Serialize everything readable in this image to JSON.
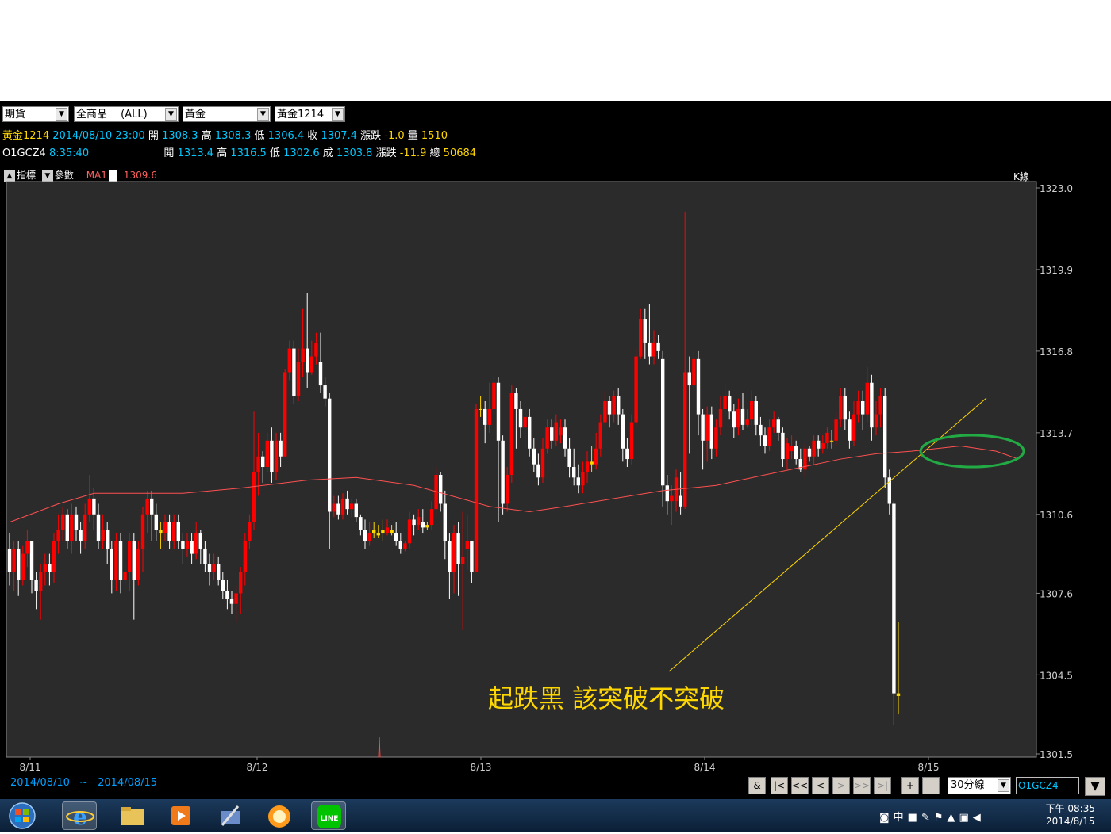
{
  "selectors": [
    {
      "value": "期貨"
    },
    {
      "value": "全商品 　(ALL)"
    },
    {
      "value": "黃金"
    },
    {
      "value": "黃金1214"
    }
  ],
  "quote1": {
    "name": "黃金1214",
    "datetime": "2014/08/10 23:00",
    "open_label": "開",
    "open": "1308.3",
    "high_label": "高",
    "high": "1308.3",
    "low_label": "低",
    "low": "1306.4",
    "close_label": "收",
    "close": "1307.4",
    "change_label": "漲跌",
    "change": "-1.0",
    "volume_label": "量",
    "volume": "1510"
  },
  "quote2": {
    "name": "O1GCZ4",
    "time": "8:35:40",
    "open_label": "開",
    "open": "1313.4",
    "high_label": "高",
    "high": "1316.5",
    "low_label": "低",
    "low": "1302.6",
    "close_label": "成",
    "close": "1303.8",
    "change_label": "漲跌",
    "change": "-11.9",
    "volume_label": "總",
    "volume": "50684"
  },
  "toolbar": {
    "indicator_label": "指標",
    "param_label": "參數",
    "ma_label": "MA1",
    "ma_value": "1309.6",
    "k_label": "K線"
  },
  "range": {
    "from": "2014/08/10",
    "sep": "~",
    "to": "2014/08/15"
  },
  "nav": {
    "amp": "&",
    "first": "|<",
    "fastback": "<<",
    "back": "<",
    "fwd": ">",
    "fastfwd": ">>",
    "last": ">|",
    "zoom_in": "+",
    "zoom_out": "-",
    "period": "30分線",
    "code": "O1GCZ4"
  },
  "annotation": "起跌黑 該突破不突破",
  "taskbar": {
    "time": "下午 08:35",
    "date": "2014/8/15",
    "ime": "中",
    "apps": [
      "windows-start",
      "internet-explorer",
      "file-explorer",
      "media-player",
      "tool-app",
      "chat-app",
      "line"
    ]
  },
  "colors": {
    "background": "#000000",
    "plot_bg": "#2b2b2b",
    "up": "#ff0000",
    "down": "#ffffff",
    "doji": "#ffd700",
    "ma": "#ff5050",
    "trendline": "#ffd700",
    "ellipse": "#22aa44"
  },
  "chart_data": {
    "type": "candlestick",
    "title": "",
    "xlabel": "",
    "ylabel": "",
    "ylim": [
      1301.5,
      1323.0
    ],
    "y_ticks": [
      "1323.0",
      "1319.9",
      "1316.8",
      "1313.7",
      "1310.6",
      "1307.6",
      "1304.5",
      "1301.5"
    ],
    "x_ticks": [
      "8/11",
      "8/12",
      "8/13",
      "8/14",
      "8/15"
    ],
    "candles": [
      [
        1309.3,
        1308.4,
        1309.9,
        1307.9
      ],
      [
        1308.4,
        1309.3,
        1309.6,
        1307.7
      ],
      [
        1309.3,
        1308.1,
        1309.6,
        1307.5
      ],
      [
        1308.1,
        1309.1,
        1309.4,
        1307.9
      ],
      [
        1309.1,
        1309.6,
        1310.0,
        1308.6
      ],
      [
        1309.6,
        1308.1,
        1309.6,
        1307.6
      ],
      [
        1308.1,
        1307.7,
        1308.4,
        1307.0
      ],
      [
        1307.7,
        1308.4,
        1308.7,
        1306.6
      ],
      [
        1308.4,
        1308.7,
        1309.1,
        1307.9
      ],
      [
        1308.7,
        1308.4,
        1309.1,
        1307.9
      ],
      [
        1308.4,
        1309.6,
        1309.9,
        1308.0
      ],
      [
        1309.6,
        1310.0,
        1310.6,
        1309.1
      ],
      [
        1310.0,
        1310.6,
        1310.9,
        1309.6
      ],
      [
        1310.6,
        1309.6,
        1310.8,
        1309.3
      ],
      [
        1309.6,
        1310.6,
        1311.0,
        1309.1
      ],
      [
        1310.6,
        1310.0,
        1310.9,
        1309.6
      ],
      [
        1310.0,
        1309.6,
        1310.3,
        1309.1
      ],
      [
        1309.6,
        1310.6,
        1311.0,
        1309.3
      ],
      [
        1310.6,
        1311.2,
        1312.1,
        1310.3
      ],
      [
        1311.2,
        1310.6,
        1311.6,
        1310.0
      ],
      [
        1310.6,
        1309.6,
        1311.0,
        1309.3
      ],
      [
        1309.6,
        1310.0,
        1310.6,
        1309.3
      ],
      [
        1310.0,
        1309.3,
        1310.3,
        1308.7
      ],
      [
        1309.3,
        1308.1,
        1309.6,
        1307.6
      ],
      [
        1308.1,
        1309.6,
        1309.9,
        1307.7
      ],
      [
        1309.6,
        1308.1,
        1309.9,
        1307.6
      ],
      [
        1308.1,
        1308.4,
        1308.7,
        1307.9
      ],
      [
        1308.4,
        1309.6,
        1309.9,
        1307.7
      ],
      [
        1309.6,
        1308.1,
        1309.9,
        1306.6
      ],
      [
        1308.1,
        1309.3,
        1309.6,
        1307.9
      ],
      [
        1309.3,
        1310.6,
        1310.9,
        1308.4
      ],
      [
        1310.6,
        1311.2,
        1311.5,
        1309.9
      ],
      [
        1311.2,
        1310.6,
        1311.5,
        1309.6
      ],
      [
        1310.6,
        1310.0,
        1311.0,
        1309.6
      ],
      [
        1310.0,
        1309.9,
        1310.3,
        1309.3
      ],
      [
        1309.9,
        1310.3,
        1310.6,
        1309.6
      ],
      [
        1310.3,
        1309.6,
        1310.6,
        1309.3
      ],
      [
        1309.6,
        1310.3,
        1310.6,
        1309.3
      ],
      [
        1310.3,
        1309.6,
        1310.6,
        1309.3
      ],
      [
        1309.6,
        1309.3,
        1309.9,
        1308.7
      ],
      [
        1309.3,
        1309.6,
        1309.9,
        1309.0
      ],
      [
        1309.6,
        1309.1,
        1309.9,
        1308.7
      ],
      [
        1309.1,
        1309.9,
        1310.3,
        1308.9
      ],
      [
        1309.9,
        1309.3,
        1310.0,
        1308.7
      ],
      [
        1309.3,
        1308.7,
        1309.6,
        1308.4
      ],
      [
        1308.7,
        1308.4,
        1309.1,
        1307.9
      ],
      [
        1308.4,
        1308.7,
        1309.1,
        1308.1
      ],
      [
        1308.7,
        1308.1,
        1309.0,
        1307.9
      ],
      [
        1308.1,
        1307.7,
        1308.4,
        1307.4
      ],
      [
        1307.7,
        1307.4,
        1308.1,
        1307.0
      ],
      [
        1307.4,
        1307.2,
        1307.7,
        1306.8
      ],
      [
        1307.2,
        1307.6,
        1307.9,
        1306.5
      ],
      [
        1307.6,
        1308.4,
        1308.6,
        1306.8
      ],
      [
        1308.4,
        1309.6,
        1309.9,
        1307.9
      ],
      [
        1309.6,
        1310.3,
        1310.6,
        1309.3
      ],
      [
        1310.3,
        1312.2,
        1314.5,
        1310.0
      ],
      [
        1312.2,
        1312.8,
        1313.7,
        1311.3
      ],
      [
        1312.8,
        1312.4,
        1313.0,
        1311.8
      ],
      [
        1312.4,
        1313.4,
        1313.7,
        1312.2
      ],
      [
        1313.4,
        1312.2,
        1313.9,
        1311.8
      ],
      [
        1312.2,
        1313.4,
        1313.7,
        1311.9
      ],
      [
        1313.4,
        1312.8,
        1313.7,
        1312.4
      ],
      [
        1312.8,
        1316.0,
        1316.1,
        1312.8
      ],
      [
        1316.0,
        1316.9,
        1317.2,
        1315.7
      ],
      [
        1316.9,
        1315.1,
        1317.2,
        1314.8
      ],
      [
        1315.1,
        1316.4,
        1316.9,
        1314.9
      ],
      [
        1316.4,
        1316.9,
        1318.4,
        1315.8
      ],
      [
        1316.9,
        1316.0,
        1319.0,
        1315.4
      ],
      [
        1316.0,
        1316.6,
        1317.2,
        1315.9
      ],
      [
        1316.6,
        1317.1,
        1317.5,
        1316.3
      ],
      [
        1316.4,
        1315.5,
        1317.5,
        1315.2
      ],
      [
        1315.5,
        1315.0,
        1315.8,
        1314.7
      ],
      [
        1315.0,
        1310.7,
        1315.2,
        1309.3
      ],
      [
        1310.7,
        1311.0,
        1311.3,
        1310.5
      ],
      [
        1311.0,
        1310.6,
        1311.3,
        1310.4
      ],
      [
        1310.6,
        1311.2,
        1311.4,
        1310.4
      ],
      [
        1311.2,
        1310.8,
        1311.5,
        1310.6
      ],
      [
        1310.8,
        1311.0,
        1311.2,
        1310.5
      ],
      [
        1311.0,
        1310.5,
        1311.2,
        1310.3
      ],
      [
        1310.5,
        1310.0,
        1310.6,
        1309.8
      ],
      [
        1310.0,
        1309.6,
        1310.4,
        1309.3
      ],
      [
        1309.6,
        1309.9,
        1310.3,
        1309.4
      ],
      [
        1309.9,
        1310.0,
        1310.3,
        1309.7
      ],
      [
        1309.8,
        1309.9,
        1310.2,
        1309.7
      ],
      [
        1309.9,
        1310.0,
        1310.4,
        1309.6
      ],
      [
        1309.9,
        1310.1,
        1310.4,
        1309.8
      ],
      [
        1309.9,
        1310.0,
        1310.2,
        1309.8
      ],
      [
        1309.9,
        1309.6,
        1310.3,
        1309.4
      ],
      [
        1309.6,
        1309.3,
        1309.9,
        1309.1
      ],
      [
        1309.3,
        1309.5,
        1309.6,
        1309.2
      ],
      [
        1309.5,
        1310.4,
        1310.7,
        1309.3
      ],
      [
        1310.4,
        1310.2,
        1310.6,
        1309.8
      ],
      [
        1310.2,
        1310.5,
        1310.8,
        1310.0
      ],
      [
        1310.3,
        1310.1,
        1310.8,
        1309.9
      ],
      [
        1310.1,
        1310.2,
        1310.3,
        1310.0
      ],
      [
        1310.2,
        1310.8,
        1311.1,
        1310.0
      ],
      [
        1310.8,
        1312.1,
        1312.4,
        1310.5
      ],
      [
        1312.1,
        1311.0,
        1312.2,
        1310.7
      ],
      [
        1311.0,
        1309.6,
        1311.5,
        1308.9
      ],
      [
        1309.6,
        1308.4,
        1309.9,
        1307.4
      ],
      [
        1308.4,
        1309.9,
        1310.2,
        1307.6
      ],
      [
        1309.9,
        1308.7,
        1310.3,
        1307.5
      ],
      [
        1308.7,
        1309.0,
        1310.7,
        1306.2
      ],
      [
        1309.3,
        1309.6,
        1310.6,
        1308.5
      ],
      [
        1309.6,
        1308.4,
        1309.6,
        1308.0
      ],
      [
        1308.4,
        1314.6,
        1314.8,
        1308.4
      ],
      [
        1314.6,
        1314.6,
        1315.1,
        1314.3
      ],
      [
        1314.6,
        1314.0,
        1314.9,
        1313.3
      ],
      [
        1314.0,
        1314.6,
        1315.6,
        1313.7
      ],
      [
        1314.6,
        1315.6,
        1315.9,
        1314.4
      ],
      [
        1315.6,
        1313.4,
        1315.8,
        1310.3
      ],
      [
        1313.4,
        1311.0,
        1313.6,
        1310.6
      ],
      [
        1311.0,
        1312.1,
        1312.4,
        1310.7
      ],
      [
        1312.1,
        1315.2,
        1315.5,
        1311.8
      ],
      [
        1315.2,
        1314.6,
        1315.4,
        1313.1
      ],
      [
        1314.6,
        1313.9,
        1314.9,
        1313.5
      ],
      [
        1313.9,
        1314.3,
        1314.6,
        1313.1
      ],
      [
        1314.3,
        1313.1,
        1314.6,
        1312.8
      ],
      [
        1313.1,
        1312.5,
        1313.5,
        1312.2
      ],
      [
        1312.5,
        1312.0,
        1312.9,
        1311.7
      ],
      [
        1312.0,
        1313.1,
        1313.5,
        1311.8
      ],
      [
        1313.1,
        1313.9,
        1314.2,
        1312.9
      ],
      [
        1313.9,
        1313.4,
        1314.2,
        1313.1
      ],
      [
        1313.4,
        1314.1,
        1314.4,
        1313.2
      ],
      [
        1313.6,
        1313.9,
        1314.2,
        1313.3
      ],
      [
        1313.9,
        1313.1,
        1314.2,
        1312.8
      ],
      [
        1313.1,
        1312.4,
        1313.5,
        1312.0
      ],
      [
        1312.4,
        1312.0,
        1313.1,
        1311.7
      ],
      [
        1312.0,
        1311.7,
        1312.5,
        1311.4
      ],
      [
        1311.7,
        1312.2,
        1312.6,
        1311.4
      ],
      [
        1312.2,
        1312.6,
        1313.0,
        1311.8
      ],
      [
        1312.6,
        1312.5,
        1313.2,
        1312.2
      ],
      [
        1312.5,
        1313.1,
        1313.7,
        1312.3
      ],
      [
        1313.1,
        1314.1,
        1314.4,
        1312.8
      ],
      [
        1314.1,
        1314.9,
        1315.3,
        1313.9
      ],
      [
        1314.9,
        1314.4,
        1315.1,
        1313.9
      ],
      [
        1314.4,
        1315.1,
        1315.3,
        1314.1
      ],
      [
        1315.1,
        1314.4,
        1315.4,
        1314.0
      ],
      [
        1314.4,
        1313.1,
        1314.6,
        1312.6
      ],
      [
        1313.1,
        1312.7,
        1313.5,
        1312.4
      ],
      [
        1312.7,
        1314.1,
        1314.4,
        1312.5
      ],
      [
        1314.1,
        1316.6,
        1316.9,
        1313.9
      ],
      [
        1316.6,
        1318.0,
        1318.4,
        1316.5
      ],
      [
        1318.0,
        1317.1,
        1318.4,
        1316.5
      ],
      [
        1317.1,
        1316.6,
        1318.6,
        1316.3
      ],
      [
        1316.6,
        1317.1,
        1317.6,
        1316.3
      ],
      [
        1317.1,
        1316.8,
        1317.4,
        1316.5
      ],
      [
        1316.5,
        1311.7,
        1316.8,
        1310.9
      ],
      [
        1311.7,
        1311.1,
        1312.1,
        1310.6
      ],
      [
        1311.1,
        1311.3,
        1311.7,
        1310.2
      ],
      [
        1311.1,
        1312.0,
        1312.3,
        1310.7
      ],
      [
        1311.3,
        1310.9,
        1312.2,
        1310.6
      ],
      [
        1310.9,
        1316.0,
        1322.1,
        1310.8
      ],
      [
        1316.0,
        1315.5,
        1316.6,
        1312.9
      ],
      [
        1315.5,
        1316.5,
        1316.8,
        1314.7
      ],
      [
        1316.5,
        1314.4,
        1316.8,
        1313.6
      ],
      [
        1314.4,
        1313.4,
        1314.6,
        1312.3
      ],
      [
        1313.4,
        1314.4,
        1314.7,
        1312.6
      ],
      [
        1314.4,
        1313.1,
        1314.7,
        1312.7
      ],
      [
        1313.1,
        1313.9,
        1314.2,
        1312.8
      ],
      [
        1313.9,
        1314.6,
        1315.1,
        1313.6
      ],
      [
        1314.6,
        1315.1,
        1315.6,
        1314.3
      ],
      [
        1315.1,
        1314.5,
        1315.3,
        1314.2
      ],
      [
        1314.5,
        1313.9,
        1314.8,
        1313.5
      ],
      [
        1313.9,
        1314.6,
        1315.0,
        1313.6
      ],
      [
        1314.6,
        1314.0,
        1315.2,
        1313.8
      ],
      [
        1314.0,
        1314.2,
        1314.6,
        1313.9
      ],
      [
        1314.2,
        1314.9,
        1315.3,
        1314.0
      ],
      [
        1314.9,
        1314.0,
        1315.1,
        1313.6
      ],
      [
        1314.0,
        1313.6,
        1314.3,
        1313.2
      ],
      [
        1313.6,
        1313.2,
        1313.9,
        1312.9
      ],
      [
        1313.2,
        1313.9,
        1314.2,
        1313.0
      ],
      [
        1313.9,
        1314.2,
        1314.5,
        1313.7
      ],
      [
        1314.2,
        1313.7,
        1314.3,
        1313.4
      ],
      [
        1313.7,
        1312.7,
        1313.9,
        1312.4
      ],
      [
        1312.7,
        1313.3,
        1313.5,
        1312.3
      ],
      [
        1313.0,
        1313.2,
        1313.6,
        1312.7
      ],
      [
        1313.2,
        1312.7,
        1313.4,
        1312.5
      ],
      [
        1312.7,
        1312.3,
        1313.1,
        1312.2
      ],
      [
        1312.3,
        1313.1,
        1313.3,
        1312.0
      ],
      [
        1313.1,
        1312.8,
        1313.2,
        1312.6
      ],
      [
        1312.8,
        1313.4,
        1313.6,
        1312.5
      ],
      [
        1313.4,
        1313.1,
        1313.6,
        1312.8
      ],
      [
        1313.1,
        1313.3,
        1313.6,
        1312.9
      ],
      [
        1313.3,
        1313.7,
        1313.9,
        1313.1
      ],
      [
        1313.4,
        1313.4,
        1313.8,
        1313.1
      ],
      [
        1313.4,
        1314.2,
        1314.5,
        1313.2
      ],
      [
        1314.2,
        1315.1,
        1315.4,
        1313.9
      ],
      [
        1315.1,
        1314.2,
        1315.4,
        1313.8
      ],
      [
        1314.2,
        1313.4,
        1314.5,
        1313.1
      ],
      [
        1313.4,
        1314.4,
        1314.9,
        1313.2
      ],
      [
        1314.4,
        1314.9,
        1315.3,
        1314.1
      ],
      [
        1314.9,
        1314.4,
        1315.3,
        1313.8
      ],
      [
        1314.4,
        1315.6,
        1316.2,
        1314.1
      ],
      [
        1315.6,
        1313.9,
        1315.9,
        1313.4
      ],
      [
        1313.9,
        1314.4,
        1314.9,
        1313.6
      ],
      [
        1314.4,
        1315.1,
        1315.4,
        1313.9
      ],
      [
        1315.1,
        1312.0,
        1315.4,
        1311.6
      ],
      [
        1312.0,
        1311.0,
        1312.3,
        1310.6
      ],
      [
        1311.0,
        1303.8,
        1311.1,
        1302.6
      ],
      [
        1303.8,
        1303.7,
        1306.5,
        1303.0
      ]
    ],
    "ma_series": {
      "name": "MA1",
      "points": [
        [
          0,
          1310.3
        ],
        [
          11,
          1311.0
        ],
        [
          19,
          1311.4
        ],
        [
          39,
          1311.4
        ],
        [
          52,
          1311.6
        ],
        [
          67,
          1311.9
        ],
        [
          78,
          1312.0
        ],
        [
          91,
          1311.7
        ],
        [
          108,
          1310.9
        ],
        [
          117,
          1310.7
        ],
        [
          125,
          1310.9
        ],
        [
          147,
          1311.5
        ],
        [
          159,
          1311.7
        ],
        [
          170,
          1312.1
        ],
        [
          187,
          1312.7
        ],
        [
          195,
          1312.9
        ],
        [
          203,
          1313.0
        ],
        [
          214,
          1313.2
        ],
        [
          222,
          1313.0
        ],
        [
          227,
          1312.7
        ]
      ]
    }
  }
}
